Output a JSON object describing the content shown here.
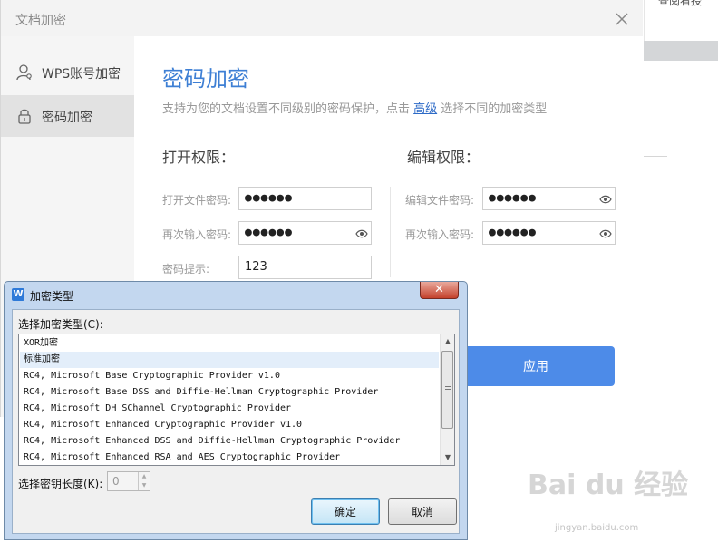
{
  "background": {
    "top_right_text": "查阅看授"
  },
  "dialog": {
    "title": "文档加密",
    "sidebar": [
      {
        "label": "WPS账号加密",
        "icon": "user-icon",
        "active": false
      },
      {
        "label": "密码加密",
        "icon": "lock-icon",
        "active": true
      }
    ],
    "main": {
      "heading": "密码加密",
      "desc_before": "支持为您的文档设置不同级别的密码保护，点击 ",
      "desc_link": "高级",
      "desc_after": " 选择不同的加密类型",
      "open_section": {
        "title": "打开权限：",
        "password_label": "打开文件密码:",
        "password_value": "●●●●●●",
        "confirm_label": "再次输入密码:",
        "confirm_value": "●●●●●●",
        "hint_label": "密码提示:",
        "hint_value": "123"
      },
      "edit_section": {
        "title": "编辑权限：",
        "password_label": "编辑文件密码:",
        "password_value": "●●●●●●",
        "confirm_label": "再次输入密码:",
        "confirm_value": "●●●●●●"
      },
      "apply_label": "应用"
    }
  },
  "modal": {
    "title": "加密类型",
    "close_glyph": "✕",
    "list_label": "选择加密类型(C):",
    "items": [
      "XOR加密",
      "标准加密",
      "RC4, Microsoft Base Cryptographic Provider v1.0",
      "RC4, Microsoft Base DSS and Diffie-Hellman Cryptographic Provider",
      "RC4, Microsoft DH SChannel Cryptographic Provider",
      "RC4, Microsoft Enhanced Cryptographic Provider v1.0",
      "RC4, Microsoft Enhanced DSS and Diffie-Hellman Cryptographic Provider",
      "RC4, Microsoft Enhanced RSA and AES Cryptographic Provider"
    ],
    "selected_index": 1,
    "key_length_label": "选择密钥长度(K):",
    "key_length_value": "0",
    "ok_label": "确定",
    "cancel_label": "取消"
  },
  "watermark": {
    "main": "Bai du 经验",
    "sub": "jingyan.baidu.com"
  }
}
